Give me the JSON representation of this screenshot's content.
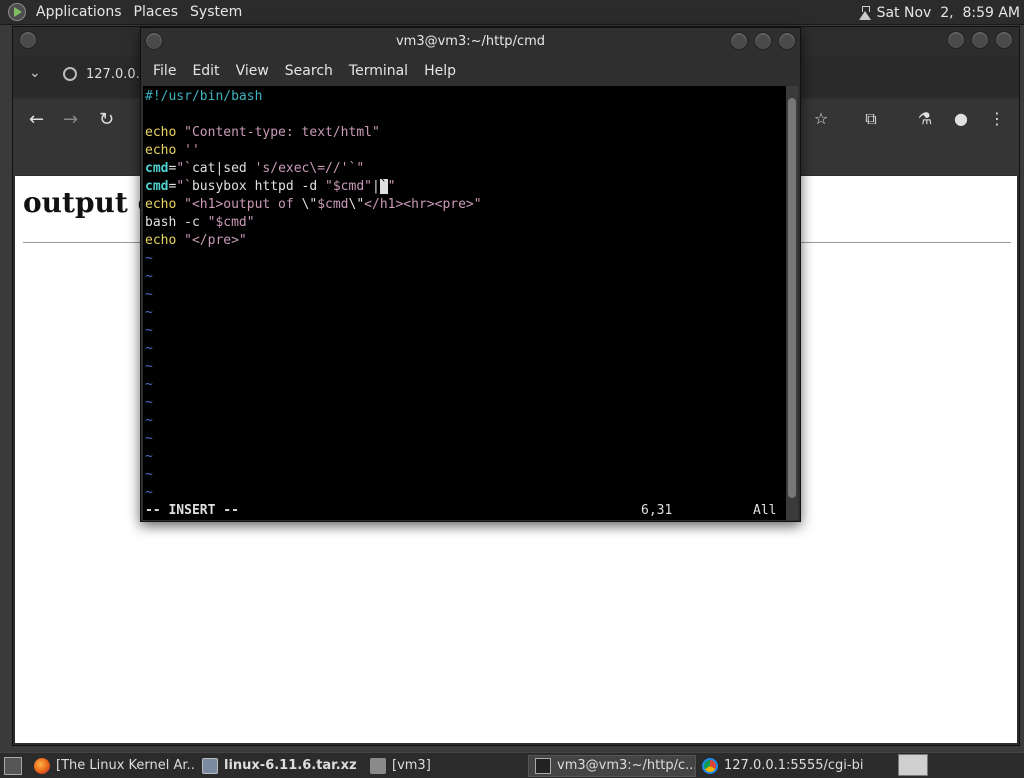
{
  "top_panel": {
    "menus": [
      "Applications",
      "Places",
      "System"
    ],
    "clock": "Sat Nov  2,  8:59 AM"
  },
  "browser": {
    "tab_title": "127.0.0.1:",
    "page_heading": "output of"
  },
  "terminal": {
    "title": "vm3@vm3:~/http/cmd",
    "menu": [
      "File",
      "Edit",
      "View",
      "Search",
      "Terminal",
      "Help"
    ],
    "mode": "-- INSERT --",
    "cursor_pos": "6,31",
    "scroll_pos": "All"
  },
  "taskbar": {
    "items": [
      "[The Linux Kernel Ar...",
      "linux-6.11.6.tar.xz",
      "[vm3]",
      "vm3@vm3:~/http/c...",
      "127.0.0.1:5555/cgi-bi..."
    ]
  },
  "code_lines": [
    "#!/usr/bin/bash",
    "",
    "echo \"Content-type: text/html\"",
    "echo ''",
    "cmd=\"`cat|sed 's/exec\\=//'`\"",
    "cmd=\"`busybox httpd -d \"$cmd\"|`\"",
    "echo \"<h1>output of \\\"$cmd\\\"</h1><hr><pre>\"",
    "bash -c \"$cmd\"",
    "echo \"</pre>\""
  ],
  "colors": {
    "terminal_bg": "#000000",
    "keyword": "#e8d460",
    "string": "#c99ab8",
    "variable": "#4fd0d0",
    "tilde": "#4a6fc0"
  }
}
